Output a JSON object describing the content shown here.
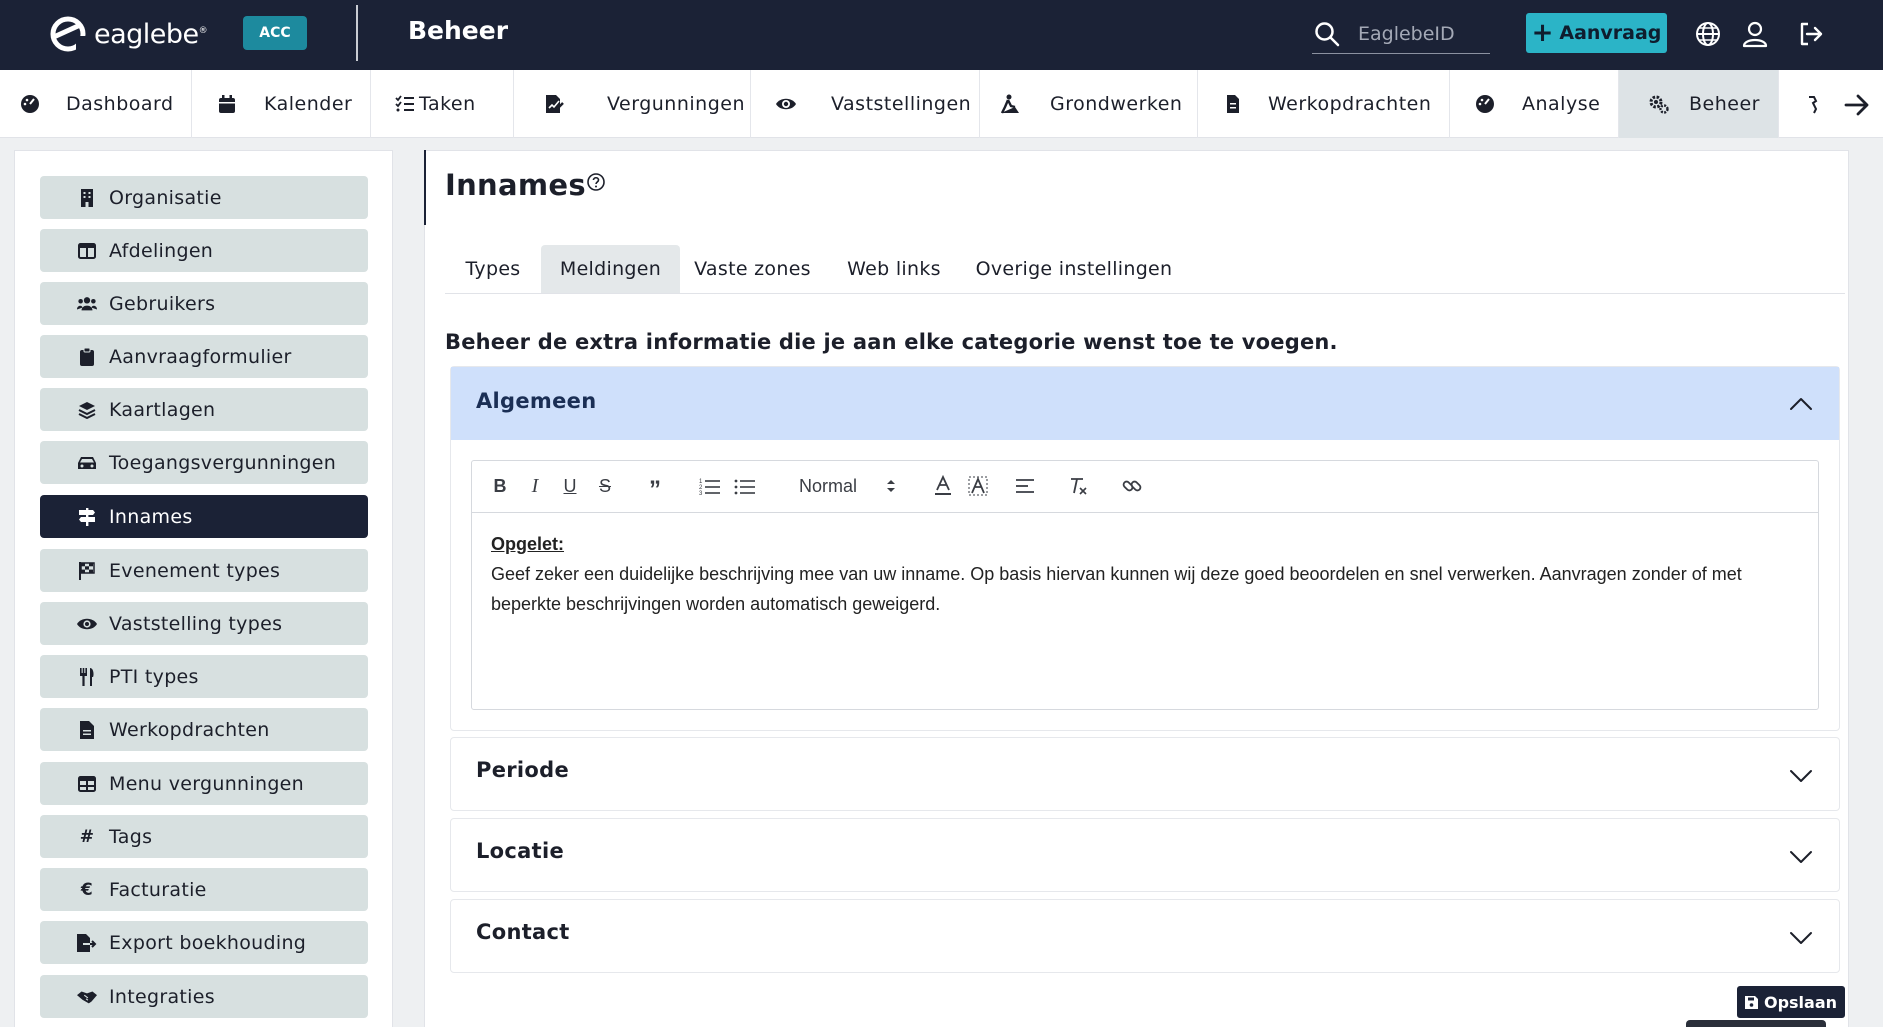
{
  "app": {
    "logo_text": "eaglebe",
    "environment_badge": "ACC",
    "section_title": "Beheer",
    "search_placeholder": "EaglebeID",
    "new_request_label": "Aanvraag",
    "brand_color": "#1b2236",
    "accent_color": "#2bb4c7"
  },
  "nav": {
    "items": [
      {
        "label": "Dashboard",
        "icon": "dashboard-icon"
      },
      {
        "label": "Kalender",
        "icon": "calendar-icon"
      },
      {
        "label": "Taken",
        "icon": "tasks-icon"
      },
      {
        "label": "Vergunningen",
        "icon": "permit-icon"
      },
      {
        "label": "Vaststellingen",
        "icon": "eye-icon"
      },
      {
        "label": "Grondwerken",
        "icon": "digging-icon"
      },
      {
        "label": "Werkopdrachten",
        "icon": "document-icon"
      },
      {
        "label": "Analyse",
        "icon": "gauge-icon"
      },
      {
        "label": "Beheer",
        "icon": "gears-icon",
        "active": true
      }
    ]
  },
  "sidebar": {
    "items": [
      {
        "label": "Organisatie",
        "icon": "building-icon"
      },
      {
        "label": "Afdelingen",
        "icon": "columns-icon"
      },
      {
        "label": "Gebruikers",
        "icon": "users-icon"
      },
      {
        "label": "Aanvraagformulier",
        "icon": "clipboard-icon"
      },
      {
        "label": "Kaartlagen",
        "icon": "layers-icon"
      },
      {
        "label": "Toegangsvergunningen",
        "icon": "car-icon"
      },
      {
        "label": "Innames",
        "icon": "signpost-icon",
        "active": true
      },
      {
        "label": "Evenement types",
        "icon": "flag-icon"
      },
      {
        "label": "Vaststelling types",
        "icon": "eye-icon"
      },
      {
        "label": "PTI types",
        "icon": "utensils-icon"
      },
      {
        "label": "Werkopdrachten",
        "icon": "file-icon"
      },
      {
        "label": "Menu vergunningen",
        "icon": "table-icon"
      },
      {
        "label": "Tags",
        "icon": "hashtag-icon"
      },
      {
        "label": "Facturatie",
        "icon": "euro-icon"
      },
      {
        "label": "Export boekhouding",
        "icon": "file-export-icon"
      },
      {
        "label": "Integraties",
        "icon": "handshake-icon"
      }
    ]
  },
  "main": {
    "title": "Innames",
    "tabs": [
      {
        "label": "Types"
      },
      {
        "label": "Meldingen",
        "active": true
      },
      {
        "label": "Vaste zones"
      },
      {
        "label": "Web links"
      },
      {
        "label": "Overige instellingen"
      }
    ],
    "description": "Beheer de extra informatie die je aan elke categorie wenst toe te voegen.",
    "accordions": [
      {
        "title": "Algemeen",
        "open": true
      },
      {
        "title": "Periode",
        "open": false
      },
      {
        "title": "Locatie",
        "open": false
      },
      {
        "title": "Contact",
        "open": false
      }
    ],
    "editor": {
      "format_select": "Normal",
      "heading": "Opgelet:",
      "body": "Geef zeker een duidelijke beschrijving mee van uw inname. Op basis hiervan kunnen wij deze goed beoordelen en snel verwerken. Aanvragen zonder of met beperkte beschrijvingen worden automatisch geweigerd."
    },
    "save_label": "Opslaan"
  }
}
